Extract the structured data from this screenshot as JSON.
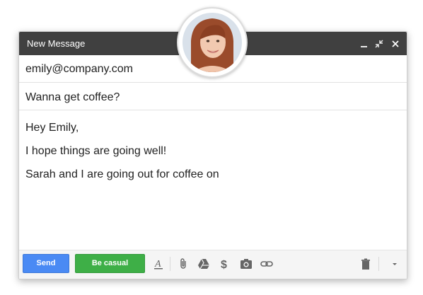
{
  "window": {
    "title": "New Message"
  },
  "fields": {
    "to_value": "emily@company.com",
    "subject_value": "Wanna get coffee?"
  },
  "body": {
    "lines": [
      "Hey Emily,",
      "I hope things are going well!",
      "Sarah and I are going out for coffee on"
    ]
  },
  "toolbar": {
    "send_label": "Send",
    "casual_label": "Be casual",
    "icons": [
      "format-text-icon",
      "attach-icon",
      "drive-icon",
      "money-icon",
      "camera-icon",
      "link-icon",
      "trash-icon",
      "more-options-icon"
    ]
  },
  "colors": {
    "titlebar": "#404040",
    "send": "#4a8af4",
    "casual": "#3eaf47"
  }
}
